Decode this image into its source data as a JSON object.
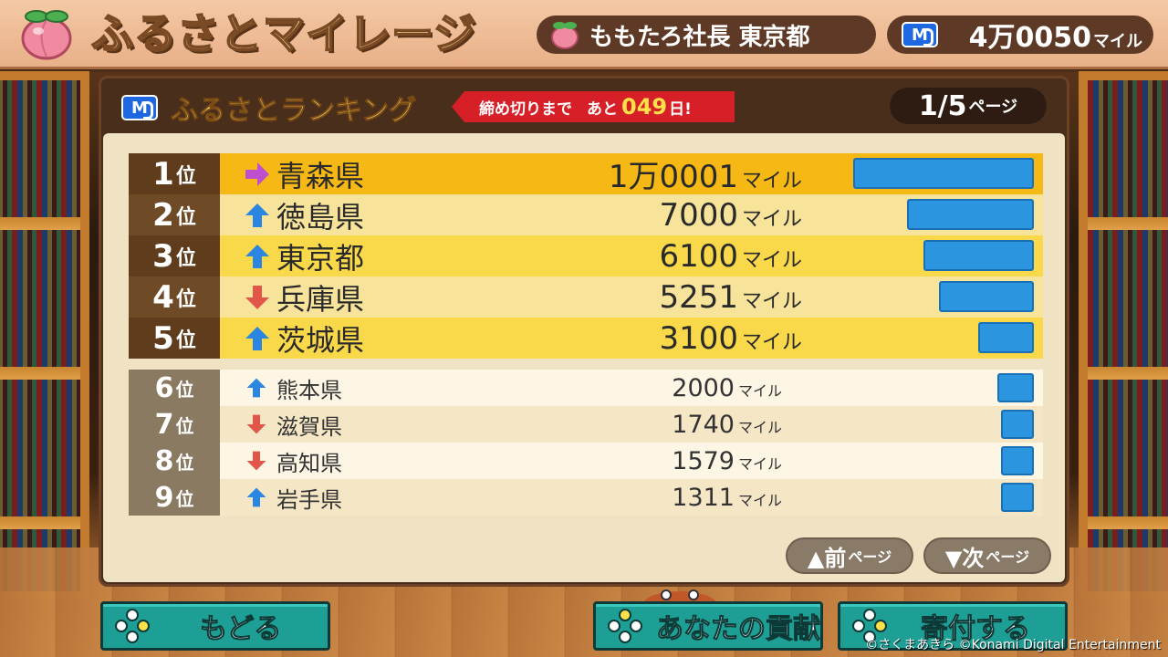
{
  "header": {
    "title": "ふるさとマイレージ",
    "player": "ももたろ社長  東京都",
    "miles_value": "4万0050",
    "miles_unit": "マイル"
  },
  "panel": {
    "title": "ふるさとランキング",
    "deadline_label": "締め切りまで",
    "deadline_ato": "あと",
    "deadline_days": "049",
    "deadline_unit": "日!",
    "page_num": "1/5",
    "page_unit": "ページ"
  },
  "rank_unit": "位",
  "mile_unit": "マイル",
  "rankings": [
    {
      "rank": "1",
      "prefecture": "青森県",
      "miles": "1万0001",
      "trend": "same",
      "bar_fraction": 1.0
    },
    {
      "rank": "2",
      "prefecture": "徳島県",
      "miles": "7000",
      "trend": "up",
      "bar_fraction": 0.7
    },
    {
      "rank": "3",
      "prefecture": "東京都",
      "miles": "6100",
      "trend": "up",
      "bar_fraction": 0.61
    },
    {
      "rank": "4",
      "prefecture": "兵庫県",
      "miles": "5251",
      "trend": "down",
      "bar_fraction": 0.525
    },
    {
      "rank": "5",
      "prefecture": "茨城県",
      "miles": "3100",
      "trend": "up",
      "bar_fraction": 0.31
    },
    {
      "rank": "6",
      "prefecture": "熊本県",
      "miles": "2000",
      "trend": "up",
      "bar_fraction": 0.2
    },
    {
      "rank": "7",
      "prefecture": "滋賀県",
      "miles": "1740",
      "trend": "down",
      "bar_fraction": 0.174
    },
    {
      "rank": "8",
      "prefecture": "高知県",
      "miles": "1579",
      "trend": "down",
      "bar_fraction": 0.158
    },
    {
      "rank": "9",
      "prefecture": "岩手県",
      "miles": "1311",
      "trend": "up",
      "bar_fraction": 0.131
    }
  ],
  "page_buttons": {
    "prev": "▲前",
    "next": "▼次",
    "unit": "ページ"
  },
  "footer": {
    "back": "もどる",
    "contribution": "あなたの貢献",
    "donate": "寄付する",
    "copyright": "©さくまあきら ©Konami Digital Entertainment"
  },
  "colors": {
    "arrow_up": "#2a86e0",
    "arrow_down": "#e0574a",
    "arrow_same": "#c04fd0",
    "bar": "#2c95e0",
    "button_teal": "#1e9f95"
  },
  "icons": {
    "up": "arrow-up-icon",
    "down": "arrow-down-icon",
    "same": "arrow-right-icon"
  }
}
